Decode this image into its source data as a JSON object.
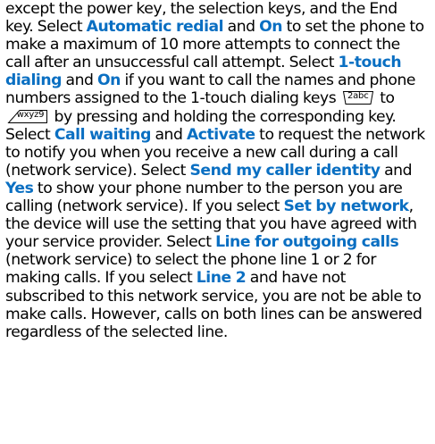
{
  "paragraph": {
    "t1": "except the power key, the selection keys, and the End key. Select ",
    "term_automatic_redial": "Automatic redial",
    "t2": " and ",
    "term_on_1": "On",
    "t3": " to set the phone to make a maximum of 10 more attempts to connect the call after an unsuccessful call attempt. Select ",
    "term_1touch": "1-touch dialing",
    "t4": " and ",
    "term_on_2": "On",
    "t5": " if you want to call the names and phone numbers assigned to the 1-touch dialing keys ",
    "key_from_label": "2abc",
    "t6": " to ",
    "key_to_label": "wxyz9",
    "t7": " by pressing and holding the corresponding key. Select ",
    "term_call_waiting": "Call waiting",
    "t8": " and ",
    "term_activate": "Activate",
    "t9": " to request the network to notify you when you receive a new call during a call (network service). Select ",
    "term_send_id": "Send my caller identity",
    "t10": " and ",
    "term_yes": "Yes",
    "t11": " to show your phone number to the person you are calling (network service). If you select ",
    "term_set_by_network": "Set by network",
    "t12": ", the device will use the setting that you have agreed with your service provider. Select ",
    "term_line_outgoing": "Line for outgoing calls",
    "t13": " (network service) to select the phone line 1 or 2 for making calls. If you select ",
    "term_line2": "Line 2",
    "t14": " and have not subscribed to this network service, you are not be able to make calls. However, calls on both lines can be answered regardless of the selected line."
  },
  "icons": {
    "key_from": "key-2abc-icon",
    "key_to": "key-wxyz9-icon"
  },
  "colors": {
    "text": "#000000",
    "term": "#0a6fc2",
    "background": "#ffffff"
  }
}
